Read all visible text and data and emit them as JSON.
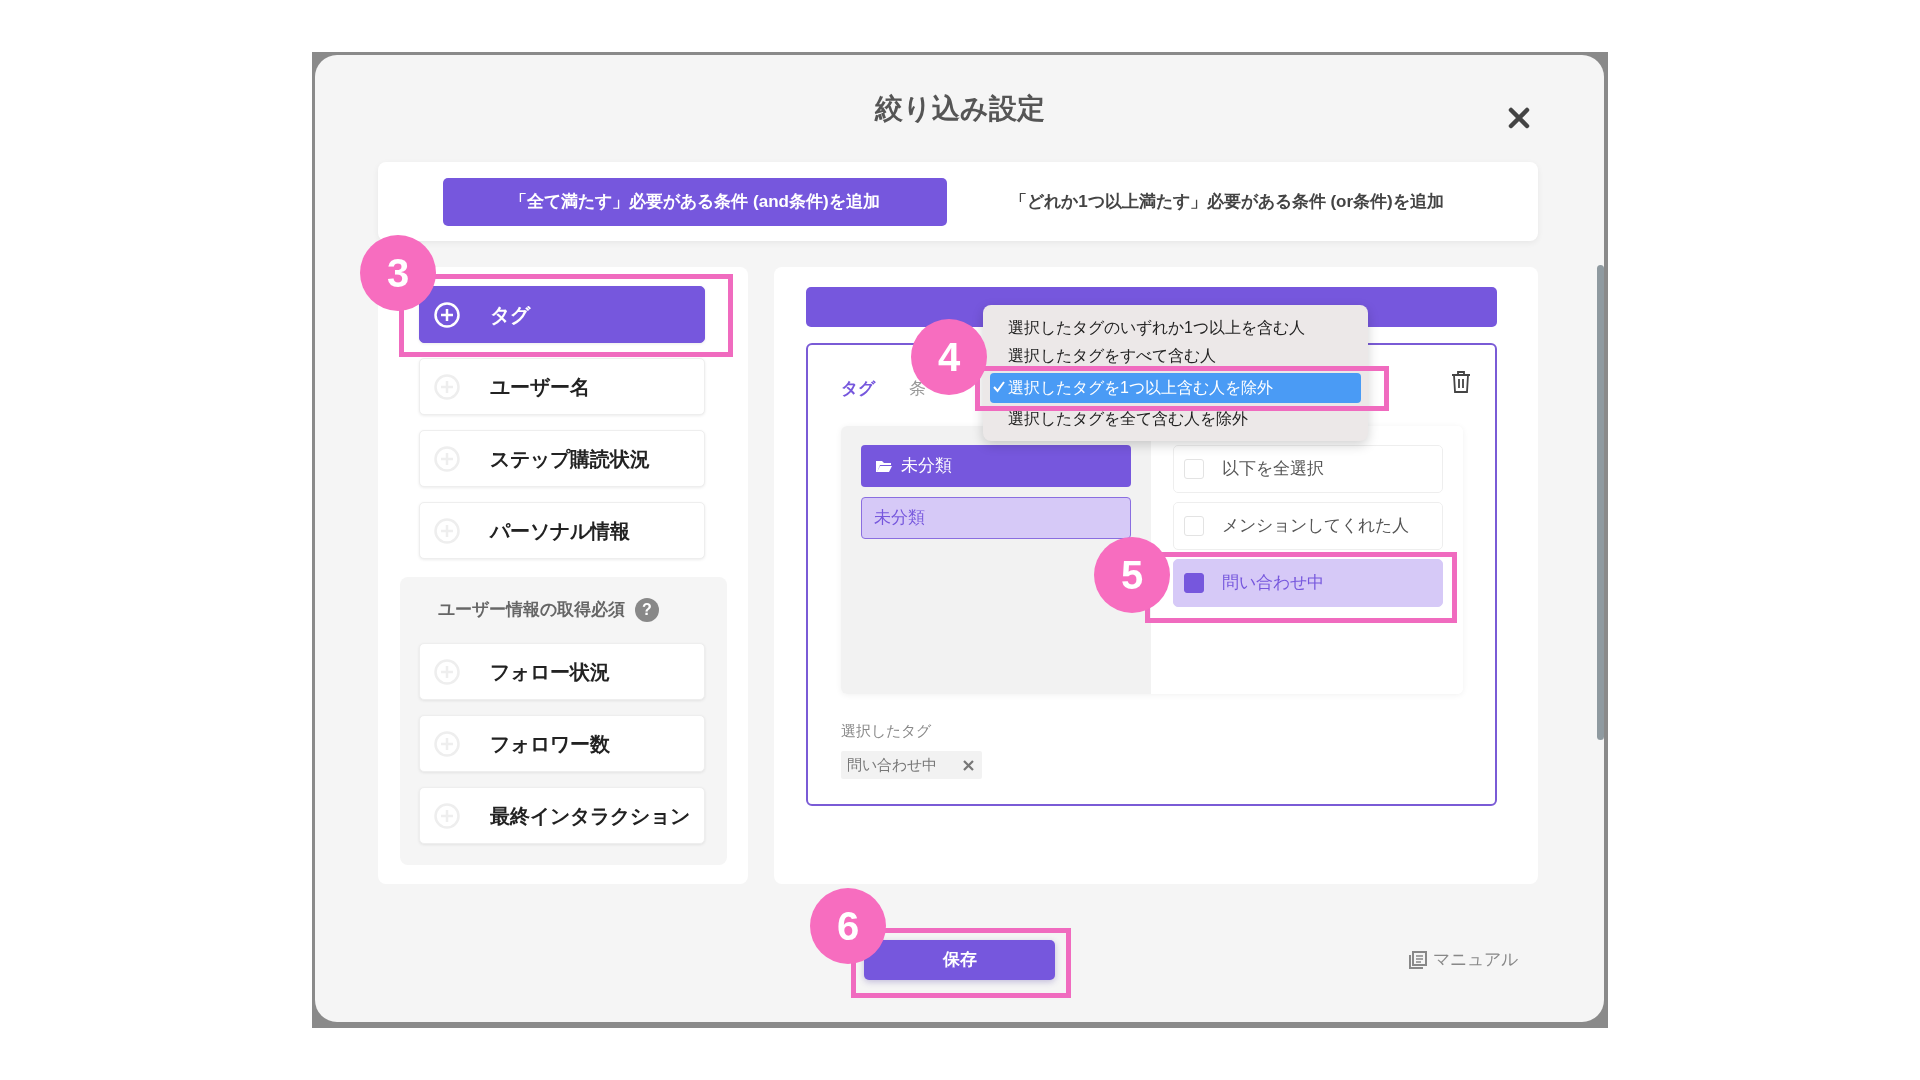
{
  "modal": {
    "title": "絞り込み設定"
  },
  "mode_tabs": [
    {
      "label": "「全て満たす」必要がある条件 (and条件)を追加",
      "selected": true
    },
    {
      "label": "「どれか1つ以上満たす」必要がある条件 (or条件)を追加",
      "selected": false
    }
  ],
  "condition_types": {
    "items": [
      {
        "label": "タグ",
        "selected": true,
        "callout": "3"
      },
      {
        "label": "ユーザー名",
        "selected": false
      },
      {
        "label": "ステップ購読状況",
        "selected": false
      },
      {
        "label": "パーソナル情報",
        "selected": false
      }
    ],
    "required_section": {
      "title": "ユーザー情報の取得必須",
      "help": "?",
      "items": [
        {
          "label": "フォロー状況",
          "selected": false
        },
        {
          "label": "フォロワー数",
          "selected": false
        },
        {
          "label": "最終インタラクション",
          "selected": false
        }
      ]
    }
  },
  "condition_editor": {
    "field_label": "タグ",
    "condition_label": "条",
    "condition_menu": [
      {
        "label": "選択したタグのいずれか1つ以上を含む人",
        "selected": false
      },
      {
        "label": "選択したタグをすべて含む人",
        "selected": false
      },
      {
        "label": "選択したタグを1つ以上含む人を除外",
        "selected": true,
        "callout": "4"
      },
      {
        "label": "選択したタグを全て含む人を除外",
        "selected": false
      }
    ],
    "folder": {
      "label": "未分類"
    },
    "categories": [
      {
        "label": "未分類",
        "selected": true
      }
    ],
    "tags": [
      {
        "label": "以下を全選択",
        "checked": false
      },
      {
        "label": "メンションしてくれた人",
        "checked": false
      },
      {
        "label": "問い合わせ中",
        "checked": true,
        "callout": "5"
      }
    ],
    "selected_label": "選択したタグ",
    "selected_tags": [
      "問い合わせ中"
    ]
  },
  "footer": {
    "save": {
      "label": "保存",
      "callout": "6"
    },
    "manual": "マニュアル"
  }
}
